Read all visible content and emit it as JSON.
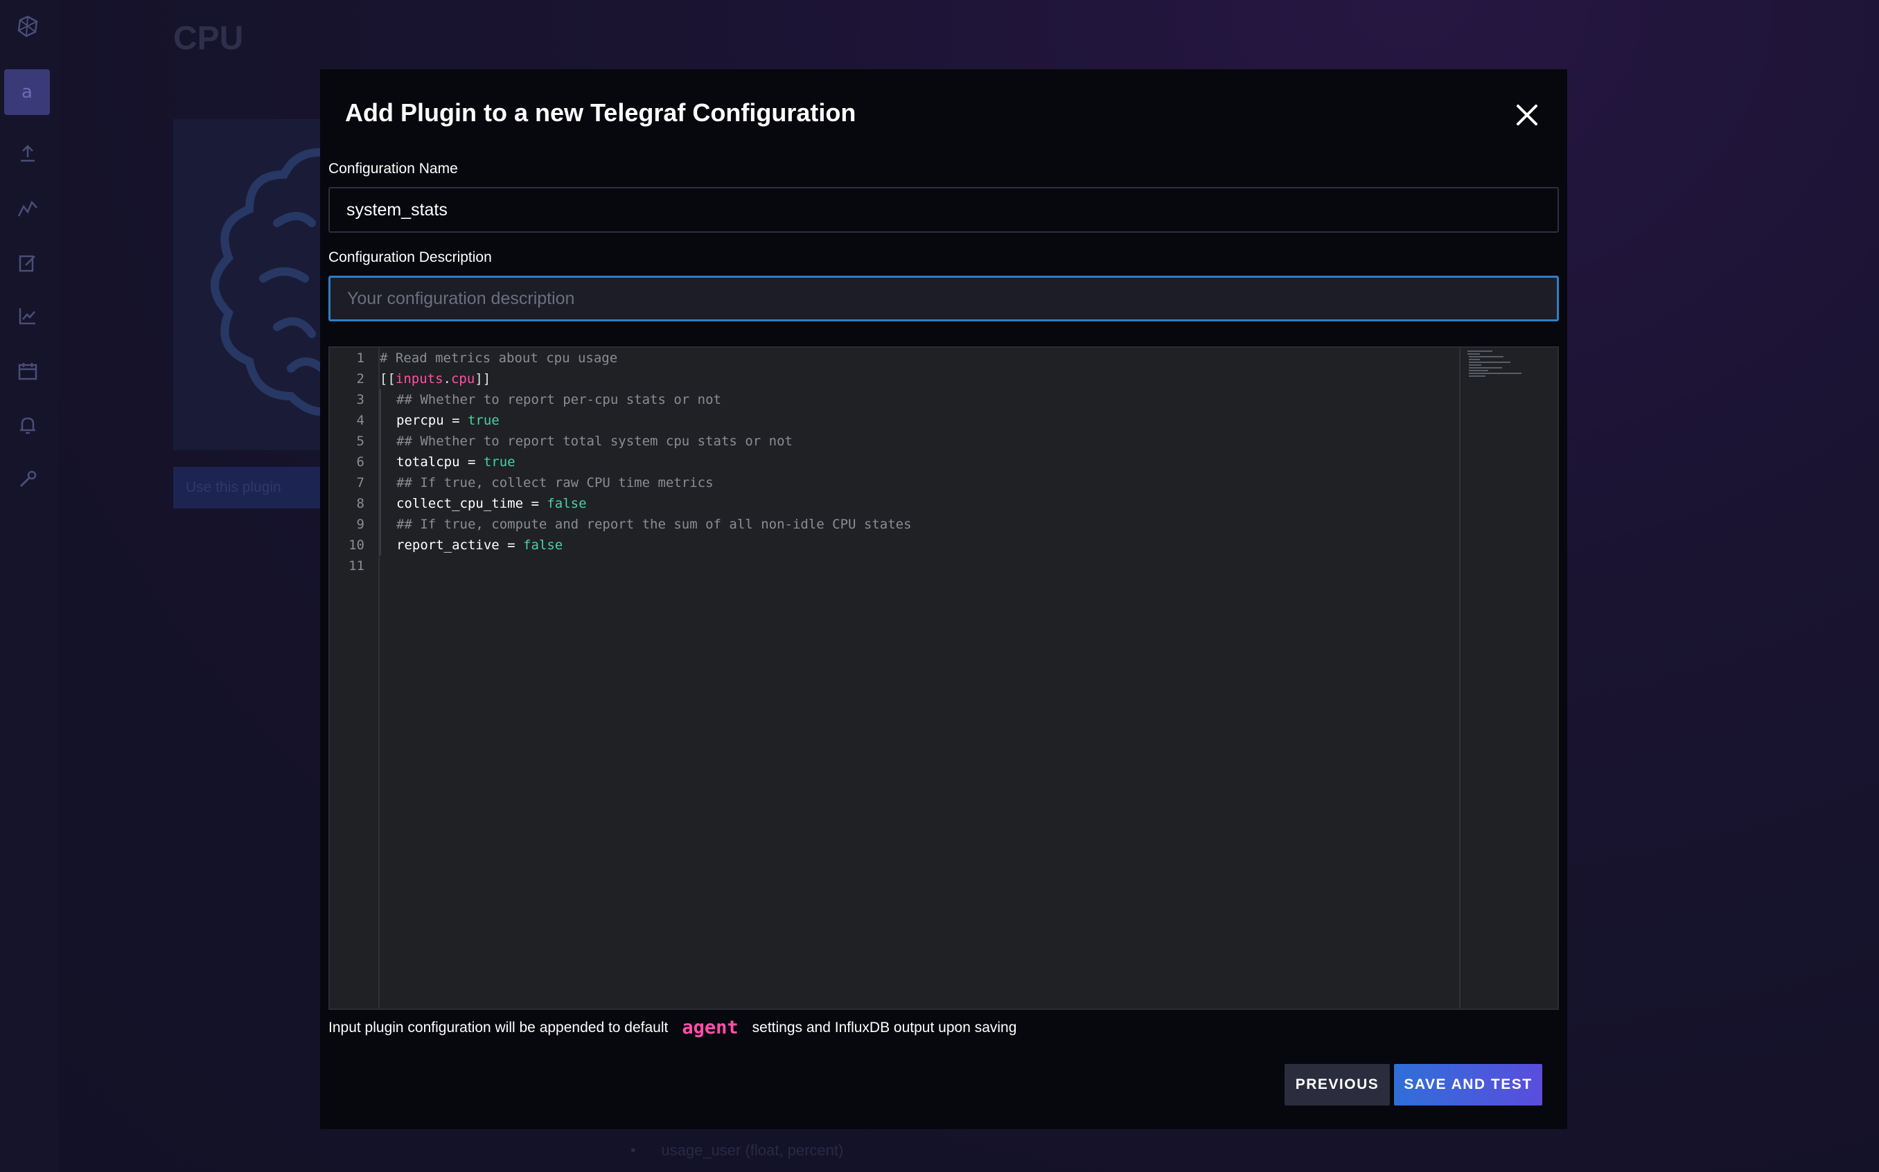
{
  "background": {
    "page_title": "CPU",
    "org_avatar_letter": "a",
    "use_plugin_label": "Use this plugin",
    "list_item": "usage_user (float, percent)",
    "sidebar_icons": [
      "influx-logo-icon",
      "upload-icon",
      "explore-icon",
      "notebook-icon",
      "dashboards-icon",
      "tasks-icon",
      "alerts-icon",
      "settings-icon"
    ]
  },
  "modal": {
    "title": "Add Plugin to a new Telegraf Configuration",
    "close_icon": "close-icon",
    "name_label": "Configuration Name",
    "name_value": "system_stats",
    "description_label": "Configuration Description",
    "description_placeholder": "Your configuration description",
    "editor": {
      "lines": [
        {
          "n": "1",
          "text": "# Read metrics about cpu usage"
        },
        {
          "n": "2",
          "text": "[[inputs.cpu]]"
        },
        {
          "n": "3",
          "text": "## Whether to report per-cpu stats or not"
        },
        {
          "n": "4",
          "text": "percpu = true"
        },
        {
          "n": "5",
          "text": "## Whether to report total system cpu stats or not"
        },
        {
          "n": "6",
          "text": "totalcpu = true"
        },
        {
          "n": "7",
          "text": "## If true, collect raw CPU time metrics"
        },
        {
          "n": "8",
          "text": "collect_cpu_time = false"
        },
        {
          "n": "9",
          "text": "## If true, compute and report the sum of all non-idle CPU states"
        },
        {
          "n": "10",
          "text": "report_active = false"
        },
        {
          "n": "11",
          "text": ""
        }
      ]
    },
    "footnote_pre": "Input plugin configuration will be appended to default",
    "footnote_agent": "agent",
    "footnote_post": "settings and InfluxDB output upon saving",
    "previous_label": "PREVIOUS",
    "save_label": "SAVE AND TEST"
  }
}
